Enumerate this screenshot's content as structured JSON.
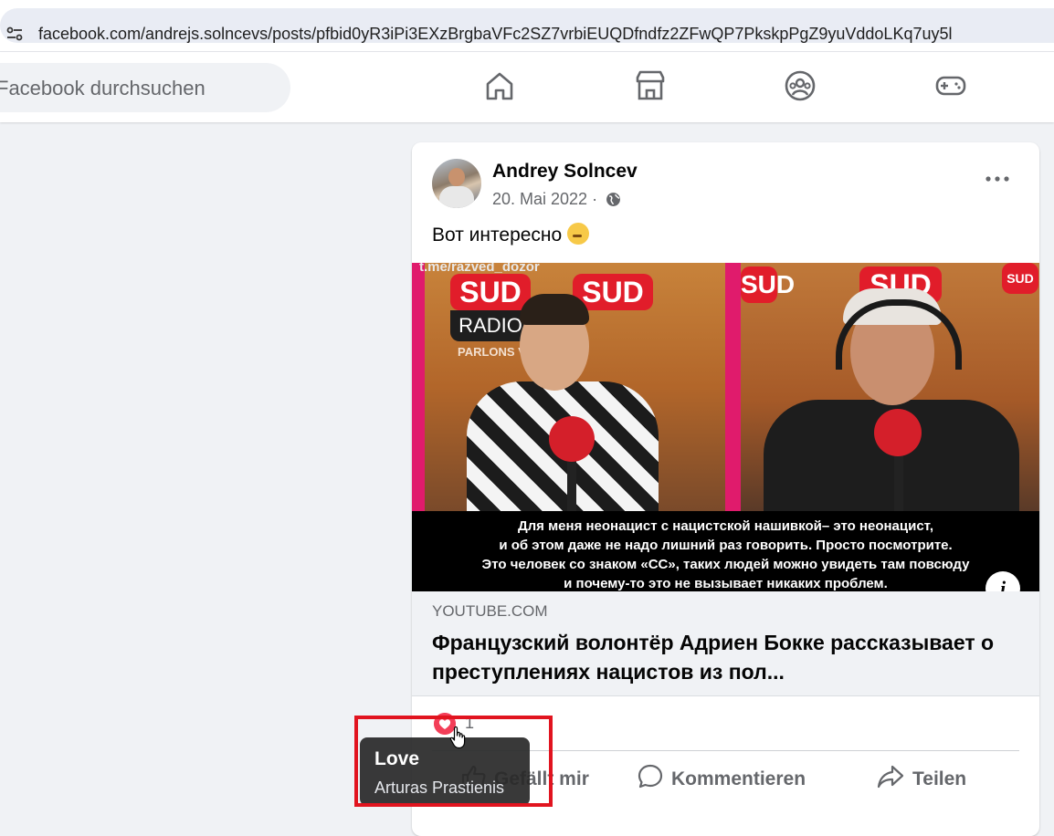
{
  "browser": {
    "url": "facebook.com/andrejs.solncevs/posts/pfbid0yR3iPi3EXzBrgbaVFc2SZ7vrbiEUQDfndfz2ZFwQP7PkskpPgZ9yuVddoLKq7uy5l"
  },
  "nav": {
    "search_placeholder": "Facebook durchsuchen",
    "icons": [
      "home-icon",
      "marketplace-icon",
      "groups-icon",
      "gaming-icon"
    ]
  },
  "post": {
    "author": "Andrey Solncev",
    "date": "20. Mai 2022 ·",
    "text": "Вот интересно",
    "video": {
      "watermark": "t.me/razved_dozor",
      "sud_label": "SUD",
      "radio_label": "RADIO",
      "parlons": "PARLONS VRAI",
      "caption": [
        "Для меня неонацист с нацистской нашивкой– это неонацист,",
        "и об этом даже не надо лишний раз говорить. Просто посмотрите.",
        "Это человек со знаком «СС», таких людей можно увидеть там повсюду",
        "и почему-то это не вызывает никаких проблем."
      ]
    },
    "link": {
      "domain": "YOUTUBE.COM",
      "title": "Французский волонтёр Адриен Бокке рассказывает о преступлениях нацистов из пол..."
    },
    "reactions": {
      "count": "1"
    },
    "actions": {
      "like": "Gefällt mir",
      "comment": "Kommentieren",
      "share": "Teilen"
    }
  },
  "tooltip": {
    "reaction": "Love",
    "user": "Arturas Prastienis"
  },
  "colors": {
    "love": "#f33e58",
    "highlight": "#e1141f"
  }
}
